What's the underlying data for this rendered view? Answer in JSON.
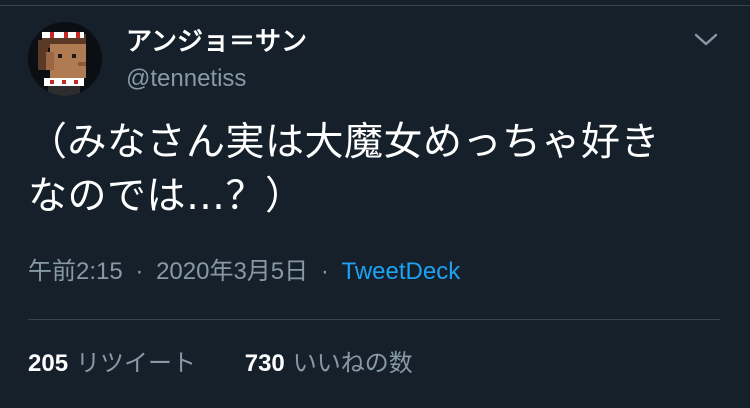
{
  "tweet": {
    "display_name": "アンジョ＝サン",
    "handle": "@tennetiss",
    "text_line1": "（みなさん実は大魔女めっちゃ好き",
    "text_line2": "なのでは…？）",
    "time": "午前2:15",
    "date": "2020年3月5日",
    "separator": "·",
    "source": "TweetDeck",
    "retweets": {
      "count": "205",
      "label": "リツイート"
    },
    "likes": {
      "count": "730",
      "label": "いいねの数"
    }
  },
  "icons": {
    "menu": "chevron-down-icon",
    "avatar": "pixel-art-avatar"
  },
  "colors": {
    "background": "#15202b",
    "text": "#ffffff",
    "secondary": "#8899a6",
    "accent": "#1da1f2",
    "divider": "#38444d"
  }
}
